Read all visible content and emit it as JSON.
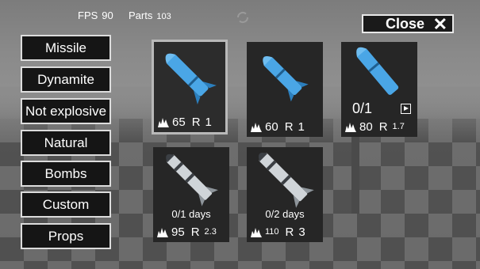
{
  "hud": {
    "fps_label": "FPS",
    "fps_value": "90",
    "parts_label": "Parts",
    "parts_value": "103"
  },
  "close_button": {
    "label": "Close",
    "icon": "close-icon"
  },
  "categories": [
    {
      "label": "Missile"
    },
    {
      "label": "Dynamite"
    },
    {
      "label": "Not explosive"
    },
    {
      "label": "Natural"
    },
    {
      "label": "Bombs"
    },
    {
      "label": "Custom"
    },
    {
      "label": "Props"
    }
  ],
  "items": [
    {
      "damage": "65",
      "r_label": "R",
      "radius": "1",
      "color": "#4aa6e6",
      "selected": true
    },
    {
      "damage": "60",
      "r_label": "R",
      "radius": "1",
      "color": "#4aa6e6"
    },
    {
      "count": "0/1",
      "damage": "80",
      "r_label": "R",
      "radius": "1.7",
      "color": "#4aa6e6",
      "icon": "watch-ad-icon"
    },
    {
      "days": "0/1 days",
      "damage": "95",
      "r_label": "R",
      "radius": "2.3",
      "color": "#cfd4d8"
    },
    {
      "days": "0/2 days",
      "damage": "110",
      "r_label": "R",
      "radius": "3",
      "color": "#cfd4d8"
    }
  ],
  "colors": {
    "button_bg": "#151515",
    "button_border": "#dcdcdc",
    "card_bg": "#262626"
  }
}
